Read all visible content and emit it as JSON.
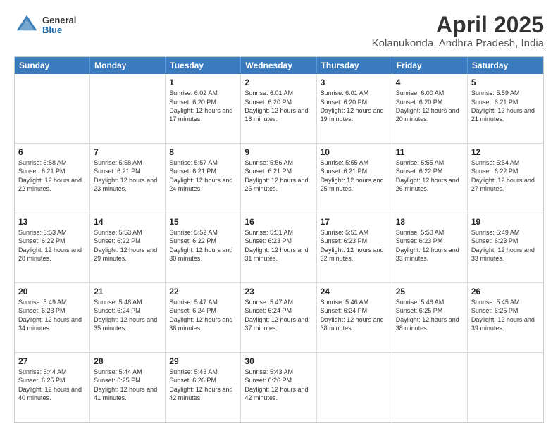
{
  "header": {
    "logo_general": "General",
    "logo_blue": "Blue",
    "title": "April 2025",
    "subtitle": "Kolanukonda, Andhra Pradesh, India"
  },
  "calendar": {
    "days": [
      "Sunday",
      "Monday",
      "Tuesday",
      "Wednesday",
      "Thursday",
      "Friday",
      "Saturday"
    ],
    "rows": [
      [
        {
          "day": "",
          "sunrise": "",
          "sunset": "",
          "daylight": ""
        },
        {
          "day": "",
          "sunrise": "",
          "sunset": "",
          "daylight": ""
        },
        {
          "day": "1",
          "sunrise": "Sunrise: 6:02 AM",
          "sunset": "Sunset: 6:20 PM",
          "daylight": "Daylight: 12 hours and 17 minutes."
        },
        {
          "day": "2",
          "sunrise": "Sunrise: 6:01 AM",
          "sunset": "Sunset: 6:20 PM",
          "daylight": "Daylight: 12 hours and 18 minutes."
        },
        {
          "day": "3",
          "sunrise": "Sunrise: 6:01 AM",
          "sunset": "Sunset: 6:20 PM",
          "daylight": "Daylight: 12 hours and 19 minutes."
        },
        {
          "day": "4",
          "sunrise": "Sunrise: 6:00 AM",
          "sunset": "Sunset: 6:20 PM",
          "daylight": "Daylight: 12 hours and 20 minutes."
        },
        {
          "day": "5",
          "sunrise": "Sunrise: 5:59 AM",
          "sunset": "Sunset: 6:21 PM",
          "daylight": "Daylight: 12 hours and 21 minutes."
        }
      ],
      [
        {
          "day": "6",
          "sunrise": "Sunrise: 5:58 AM",
          "sunset": "Sunset: 6:21 PM",
          "daylight": "Daylight: 12 hours and 22 minutes."
        },
        {
          "day": "7",
          "sunrise": "Sunrise: 5:58 AM",
          "sunset": "Sunset: 6:21 PM",
          "daylight": "Daylight: 12 hours and 23 minutes."
        },
        {
          "day": "8",
          "sunrise": "Sunrise: 5:57 AM",
          "sunset": "Sunset: 6:21 PM",
          "daylight": "Daylight: 12 hours and 24 minutes."
        },
        {
          "day": "9",
          "sunrise": "Sunrise: 5:56 AM",
          "sunset": "Sunset: 6:21 PM",
          "daylight": "Daylight: 12 hours and 25 minutes."
        },
        {
          "day": "10",
          "sunrise": "Sunrise: 5:55 AM",
          "sunset": "Sunset: 6:21 PM",
          "daylight": "Daylight: 12 hours and 25 minutes."
        },
        {
          "day": "11",
          "sunrise": "Sunrise: 5:55 AM",
          "sunset": "Sunset: 6:22 PM",
          "daylight": "Daylight: 12 hours and 26 minutes."
        },
        {
          "day": "12",
          "sunrise": "Sunrise: 5:54 AM",
          "sunset": "Sunset: 6:22 PM",
          "daylight": "Daylight: 12 hours and 27 minutes."
        }
      ],
      [
        {
          "day": "13",
          "sunrise": "Sunrise: 5:53 AM",
          "sunset": "Sunset: 6:22 PM",
          "daylight": "Daylight: 12 hours and 28 minutes."
        },
        {
          "day": "14",
          "sunrise": "Sunrise: 5:53 AM",
          "sunset": "Sunset: 6:22 PM",
          "daylight": "Daylight: 12 hours and 29 minutes."
        },
        {
          "day": "15",
          "sunrise": "Sunrise: 5:52 AM",
          "sunset": "Sunset: 6:22 PM",
          "daylight": "Daylight: 12 hours and 30 minutes."
        },
        {
          "day": "16",
          "sunrise": "Sunrise: 5:51 AM",
          "sunset": "Sunset: 6:23 PM",
          "daylight": "Daylight: 12 hours and 31 minutes."
        },
        {
          "day": "17",
          "sunrise": "Sunrise: 5:51 AM",
          "sunset": "Sunset: 6:23 PM",
          "daylight": "Daylight: 12 hours and 32 minutes."
        },
        {
          "day": "18",
          "sunrise": "Sunrise: 5:50 AM",
          "sunset": "Sunset: 6:23 PM",
          "daylight": "Daylight: 12 hours and 33 minutes."
        },
        {
          "day": "19",
          "sunrise": "Sunrise: 5:49 AM",
          "sunset": "Sunset: 6:23 PM",
          "daylight": "Daylight: 12 hours and 33 minutes."
        }
      ],
      [
        {
          "day": "20",
          "sunrise": "Sunrise: 5:49 AM",
          "sunset": "Sunset: 6:23 PM",
          "daylight": "Daylight: 12 hours and 34 minutes."
        },
        {
          "day": "21",
          "sunrise": "Sunrise: 5:48 AM",
          "sunset": "Sunset: 6:24 PM",
          "daylight": "Daylight: 12 hours and 35 minutes."
        },
        {
          "day": "22",
          "sunrise": "Sunrise: 5:47 AM",
          "sunset": "Sunset: 6:24 PM",
          "daylight": "Daylight: 12 hours and 36 minutes."
        },
        {
          "day": "23",
          "sunrise": "Sunrise: 5:47 AM",
          "sunset": "Sunset: 6:24 PM",
          "daylight": "Daylight: 12 hours and 37 minutes."
        },
        {
          "day": "24",
          "sunrise": "Sunrise: 5:46 AM",
          "sunset": "Sunset: 6:24 PM",
          "daylight": "Daylight: 12 hours and 38 minutes."
        },
        {
          "day": "25",
          "sunrise": "Sunrise: 5:46 AM",
          "sunset": "Sunset: 6:25 PM",
          "daylight": "Daylight: 12 hours and 38 minutes."
        },
        {
          "day": "26",
          "sunrise": "Sunrise: 5:45 AM",
          "sunset": "Sunset: 6:25 PM",
          "daylight": "Daylight: 12 hours and 39 minutes."
        }
      ],
      [
        {
          "day": "27",
          "sunrise": "Sunrise: 5:44 AM",
          "sunset": "Sunset: 6:25 PM",
          "daylight": "Daylight: 12 hours and 40 minutes."
        },
        {
          "day": "28",
          "sunrise": "Sunrise: 5:44 AM",
          "sunset": "Sunset: 6:25 PM",
          "daylight": "Daylight: 12 hours and 41 minutes."
        },
        {
          "day": "29",
          "sunrise": "Sunrise: 5:43 AM",
          "sunset": "Sunset: 6:26 PM",
          "daylight": "Daylight: 12 hours and 42 minutes."
        },
        {
          "day": "30",
          "sunrise": "Sunrise: 5:43 AM",
          "sunset": "Sunset: 6:26 PM",
          "daylight": "Daylight: 12 hours and 42 minutes."
        },
        {
          "day": "",
          "sunrise": "",
          "sunset": "",
          "daylight": ""
        },
        {
          "day": "",
          "sunrise": "",
          "sunset": "",
          "daylight": ""
        },
        {
          "day": "",
          "sunrise": "",
          "sunset": "",
          "daylight": ""
        }
      ]
    ]
  }
}
